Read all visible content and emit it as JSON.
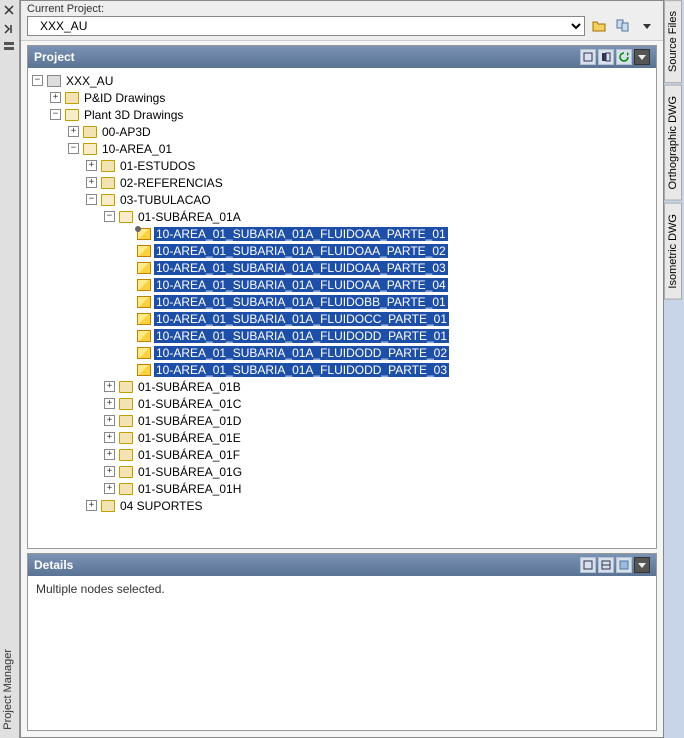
{
  "leftStrip": {
    "label": "Project Manager"
  },
  "header": {
    "label": "Current Project:",
    "selected": "XXX_AU"
  },
  "projectPanel": {
    "title": "Project"
  },
  "detailsPanel": {
    "title": "Details",
    "message": "Multiple nodes selected."
  },
  "rightTabs": [
    "Source Files",
    "Orthographic DWG",
    "Isometric DWG"
  ],
  "tree": {
    "root": "XXX_AU",
    "pid": "P&ID Drawings",
    "plant3d": "Plant 3D Drawings",
    "ap3d": "00-AP3D",
    "area01": "10-AREA_01",
    "estudos": "01-ESTUDOS",
    "referencias": "02-REFERENCIAS",
    "tubulacao": "03-TUBULACAO",
    "sub01a": "01-SUBÁREA_01A",
    "files": [
      "10-AREA_01_SUBARIA_01A_FLUIDOAA_PARTE_01",
      "10-AREA_01_SUBARIA_01A_FLUIDOAA_PARTE_02",
      "10-AREA_01_SUBARIA_01A_FLUIDOAA_PARTE_03",
      "10-AREA_01_SUBARIA_01A_FLUIDOAA_PARTE_04",
      "10-AREA_01_SUBARIA_01A_FLUIDOBB_PARTE_01",
      "10-AREA_01_SUBARIA_01A_FLUIDOCC_PARTE_01",
      "10-AREA_01_SUBARIA_01A_FLUIDODD_PARTE_01",
      "10-AREA_01_SUBARIA_01A_FLUIDODD_PARTE_02",
      "10-AREA_01_SUBARIA_01A_FLUIDODD_PARTE_03"
    ],
    "sub01b": "01-SUBÁREA_01B",
    "sub01c": "01-SUBÁREA_01C",
    "sub01d": "01-SUBÁREA_01D",
    "sub01e": "01-SUBÁREA_01E",
    "sub01f": "01-SUBÁREA_01F",
    "sub01g": "01-SUBÁREA_01G",
    "sub01h": "01-SUBÁREA_01H",
    "suportes": "04 SUPORTES"
  }
}
